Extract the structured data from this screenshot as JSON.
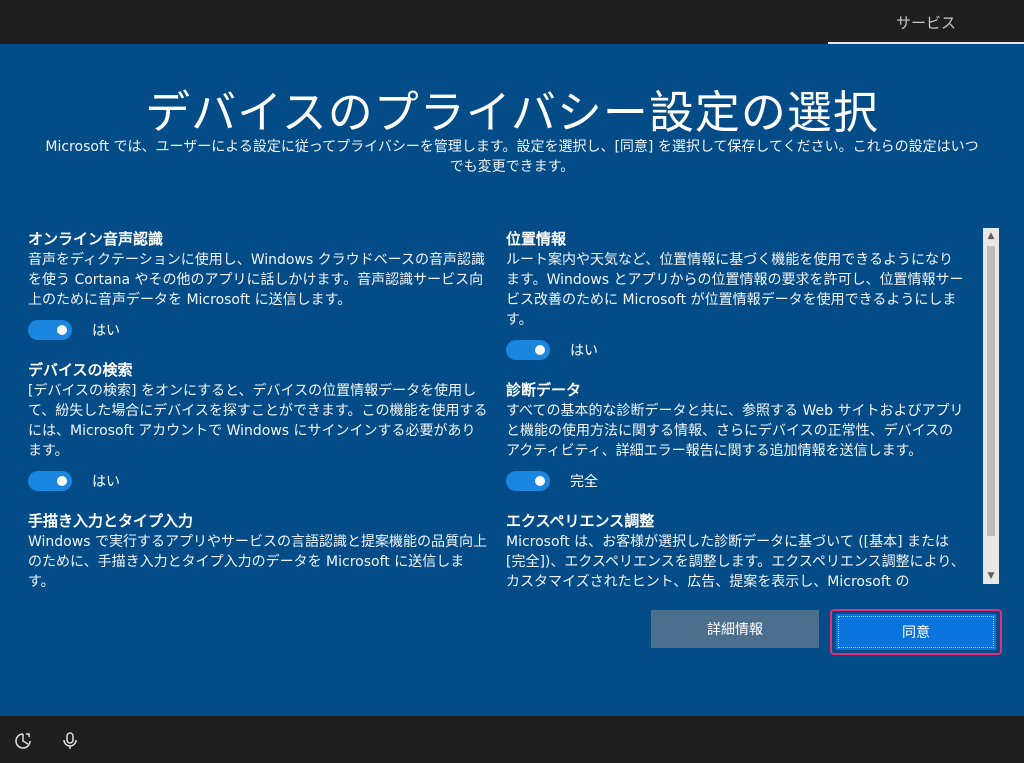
{
  "top_tab": {
    "label": "サービス"
  },
  "page": {
    "title": "デバイスのプライバシー設定の選択",
    "subtitle": "Microsoft では、ユーザーによる設定に従ってプライバシーを管理します。設定を選択し、[同意] を選択して保存してください。これらの設定はいつでも変更できます。"
  },
  "sections": {
    "speech": {
      "title": "オンライン音声認識",
      "description": "音声をディクテーションに使用し、Windows クラウドベースの音声認識を使う Cortana やその他のアプリに話しかけます。音声認識サービス向上のために音声データを Microsoft に送信します。",
      "toggle_label": "はい"
    },
    "location": {
      "title": "位置情報",
      "description": "ルート案内や天気など、位置情報に基づく機能を使用できるようになります。Windows とアプリからの位置情報の要求を許可し、位置情報サービス改善のために Microsoft が位置情報データを使用できるようにします。",
      "toggle_label": "はい"
    },
    "find_device": {
      "title": "デバイスの検索",
      "description": "[デバイスの検索] をオンにすると、デバイスの位置情報データを使用して、紛失した場合にデバイスを探すことができます。この機能を使用するには、Microsoft アカウントで Windows にサインインする必要があります。",
      "toggle_label": "はい"
    },
    "diagnostics": {
      "title": "診断データ",
      "description": "すべての基本的な診断データと共に、参照する Web サイトおよびアプリと機能の使用方法に関する情報、さらにデバイスの正常性、デバイスのアクティビティ、詳細エラー報告に関する追加情報を送信します。",
      "toggle_label": "完全"
    },
    "inking": {
      "title": "手描き入力とタイプ入力",
      "description": "Windows で実行するアプリやサービスの言語認識と提案機能の品質向上のために、手描き入力とタイプ入力のデータを Microsoft に送信します。"
    },
    "experiences": {
      "title": "エクスペリエンス調整",
      "description": "Microsoft は、お客様が選択した診断データに基づいて ([基本] または [完全])、エクスペリエンスを調整します。エクスペリエンス調整により、カスタマイズされたヒント、広告、提案を表示し、Microsoft の"
    }
  },
  "buttons": {
    "details": "詳細情報",
    "agree": "同意"
  },
  "icons": {
    "ease_of_access": "ease-of-access-icon",
    "microphone": "microphone-icon",
    "scroll_up": "scroll-up-arrow-icon",
    "scroll_down": "scroll-down-arrow-icon"
  },
  "colors": {
    "background": "#034c88",
    "toggle_on": "#1a86e0",
    "agree_button": "#0a73dd",
    "details_button": "#4d6f8e",
    "focus_border": "#e4307a"
  }
}
